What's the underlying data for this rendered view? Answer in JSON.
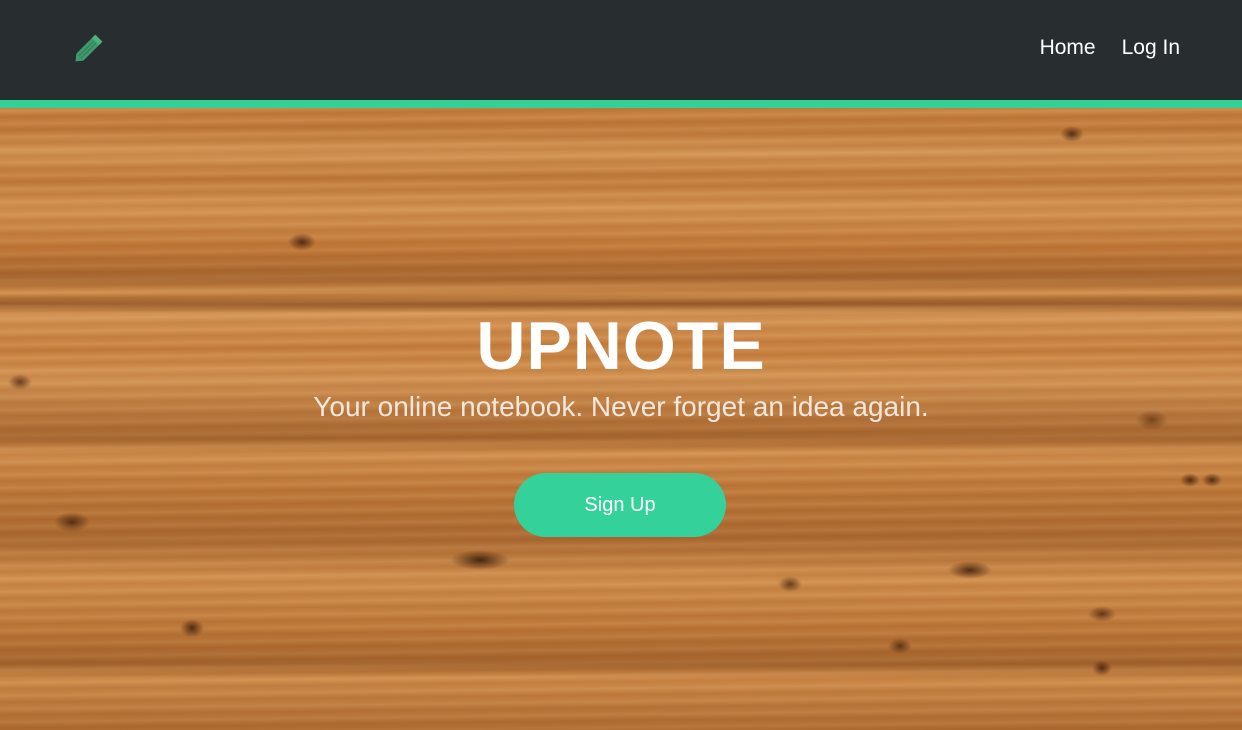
{
  "brand": {
    "logo_icon": "pencil-icon",
    "accent_color": "#34d196",
    "nav_background": "#282d30"
  },
  "nav": {
    "items": [
      {
        "label": "Home"
      },
      {
        "label": "Log In"
      }
    ]
  },
  "hero": {
    "background": "wood-texture",
    "title": "UPNOTE",
    "subtitle": "Your online notebook. Never forget an idea again.",
    "cta_label": "Sign Up",
    "cta_color": "#34d19b"
  }
}
